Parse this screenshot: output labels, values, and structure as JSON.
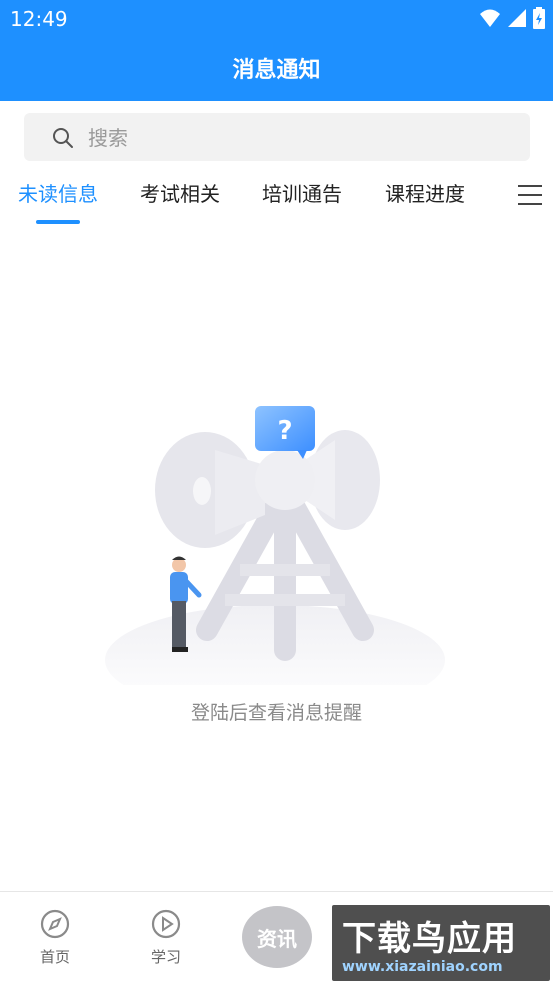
{
  "status_bar": {
    "time": "12:49",
    "icons": [
      "wifi-icon",
      "signal-icon",
      "battery-icon"
    ]
  },
  "header": {
    "title": "消息通知"
  },
  "search": {
    "placeholder": "搜索"
  },
  "tabs": [
    {
      "label": "未读信息",
      "active": true
    },
    {
      "label": "考试相关",
      "active": false
    },
    {
      "label": "培训通告",
      "active": false
    },
    {
      "label": "课程进度",
      "active": false
    }
  ],
  "empty_state": {
    "message": "登陆后查看消息提醒",
    "bubble": "?"
  },
  "bottom_nav": {
    "items": [
      {
        "label": "首页",
        "icon": "compass-icon"
      },
      {
        "label": "学习",
        "icon": "play-circle-icon"
      }
    ],
    "center_label": "资讯"
  },
  "watermark": {
    "title": "下载鸟应用",
    "url": "www.xiazainiao.com"
  },
  "colors": {
    "primary": "#1e90ff",
    "text": "#222222",
    "muted": "#8a8a8a"
  }
}
